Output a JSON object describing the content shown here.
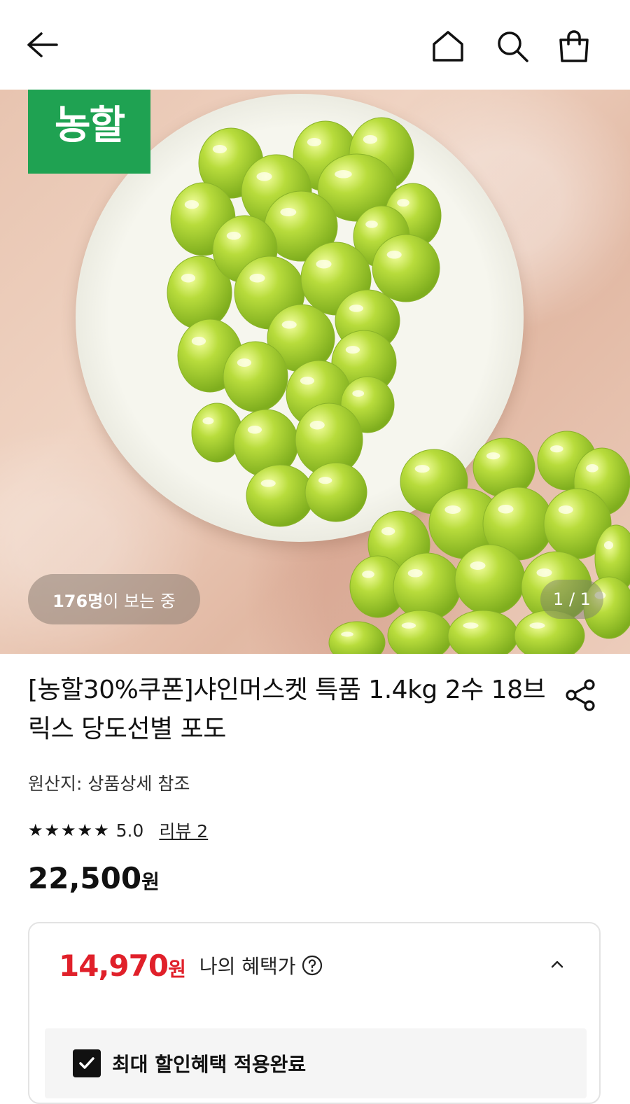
{
  "topbar": {
    "back_icon": "back-arrow-icon",
    "home_icon": "home-icon",
    "search_icon": "search-icon",
    "cart_icon": "shopping-bag-icon"
  },
  "hero": {
    "brand_badge": "농할",
    "viewers_count": "176명",
    "viewers_suffix": "이 보는 중",
    "pager": "1 / 1"
  },
  "product": {
    "title": "[농할30%쿠폰]샤인머스켓 특품 1.4kg 2수 18브릭스 당도선별 포도",
    "origin": "원산지: 상품상세 참조",
    "rating_value": "5.0",
    "star_count": 5,
    "review_link": "리뷰 2",
    "price": "22,500",
    "price_unit": "원"
  },
  "benefit": {
    "sale_price": "14,970",
    "sale_unit": "원",
    "label": "나의 혜택가",
    "checkbox_label": "최대 할인혜택 적용완료",
    "checkbox_checked": true
  },
  "colors": {
    "accent_red": "#e0202a",
    "brand_green": "#1fa252"
  }
}
